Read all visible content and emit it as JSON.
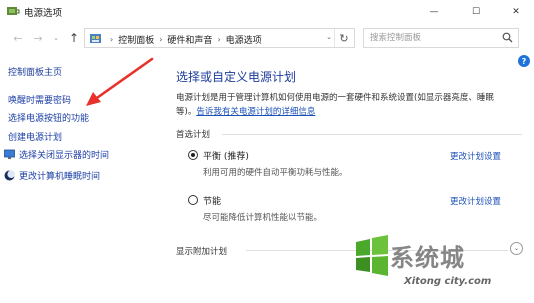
{
  "window": {
    "title": "电源选项",
    "minimize_glyph": "—",
    "maximize_glyph": "☐",
    "close_glyph": "✕"
  },
  "nav": {
    "back_glyph": "←",
    "forward_glyph": "→",
    "dropdown_glyph": "⌄",
    "up_glyph": "↑",
    "refresh_glyph": "↻",
    "breadcrumbs": [
      "控制面板",
      "硬件和声音",
      "电源选项"
    ],
    "separator": "›",
    "search_placeholder": "搜索控制面板"
  },
  "sidebar": {
    "home": "控制面板主页",
    "items": [
      {
        "label": "唤醒时需要密码",
        "icon": ""
      },
      {
        "label": "选择电源按钮的功能",
        "icon": ""
      },
      {
        "label": "创建电源计划",
        "icon": ""
      },
      {
        "label": "选择关闭显示器的时间",
        "icon": "monitor-icon"
      },
      {
        "label": "更改计算机睡眠时间",
        "icon": "moon-icon"
      }
    ]
  },
  "help": {
    "glyph": "?"
  },
  "main": {
    "title": "选择或自定义电源计划",
    "description": "电源计划是用于管理计算机如何使用电源的一套硬件和系统设置(如显示器亮度、睡眠",
    "description_line2_prefix": "等)。",
    "description_link": "告诉我有关电源计划的详细信息",
    "preferred_header": "首选计划",
    "plans": [
      {
        "name": "平衡 (推荐)",
        "desc": "利用可用的硬件自动平衡功耗与性能。",
        "link": "更改计划设置",
        "selected": true
      },
      {
        "name": "节能",
        "desc": "尽可能降低计算机性能以节能。",
        "link": "更改计划设置",
        "selected": false
      }
    ],
    "extra_header": "显示附加计划",
    "expand_glyph": "⌄"
  },
  "watermark": {
    "text": "系统城",
    "sub": "Xitong city.com"
  },
  "colors": {
    "link": "#1b4fb8",
    "arrow": "#e8312b",
    "help": "#1e74d9",
    "watermark_green": "#4aa82b"
  }
}
